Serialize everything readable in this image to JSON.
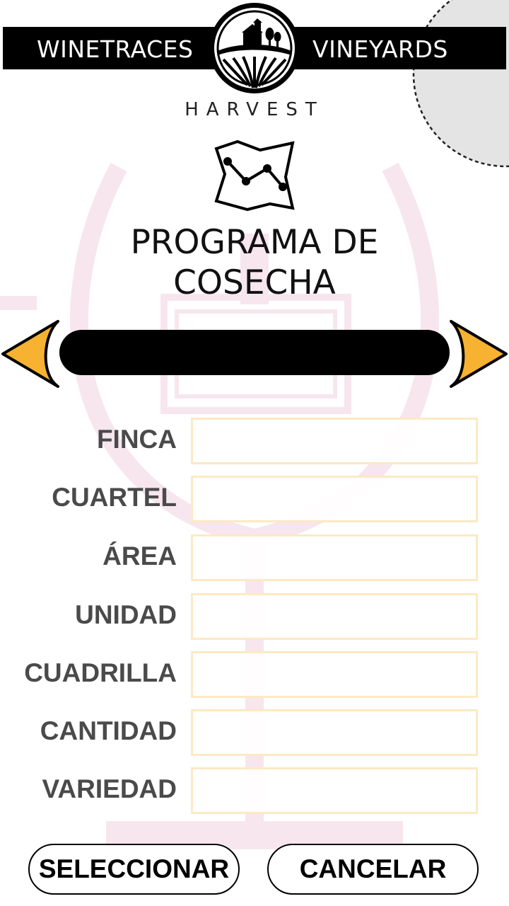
{
  "header": {
    "brand_left": "WINETRACES",
    "brand_right": "VINEYARDS",
    "subtitle": "HARVEST",
    "logo_icon": "vineyard-house-icon"
  },
  "title": {
    "line1": "PROGRAMA DE",
    "line2": "COSECHA"
  },
  "selector": {
    "value": "",
    "prev_icon": "triangle-left-icon",
    "next_icon": "triangle-right-icon"
  },
  "form": {
    "fields": [
      {
        "label": "FINCA",
        "value": ""
      },
      {
        "label": "CUARTEL",
        "value": ""
      },
      {
        "label": "ÁREA",
        "value": ""
      },
      {
        "label": "UNIDAD",
        "value": ""
      },
      {
        "label": "CUADRILLA",
        "value": ""
      },
      {
        "label": "CANTIDAD",
        "value": ""
      },
      {
        "label": "VARIEDAD",
        "value": ""
      }
    ]
  },
  "buttons": {
    "select": "SELECCIONAR",
    "cancel": "CANCELAR"
  },
  "colors": {
    "accent": "#f6b230",
    "header": "#000000",
    "label": "#4a4a4a",
    "input_border": "#fde9c4",
    "watermark": "#f7e6ee"
  }
}
